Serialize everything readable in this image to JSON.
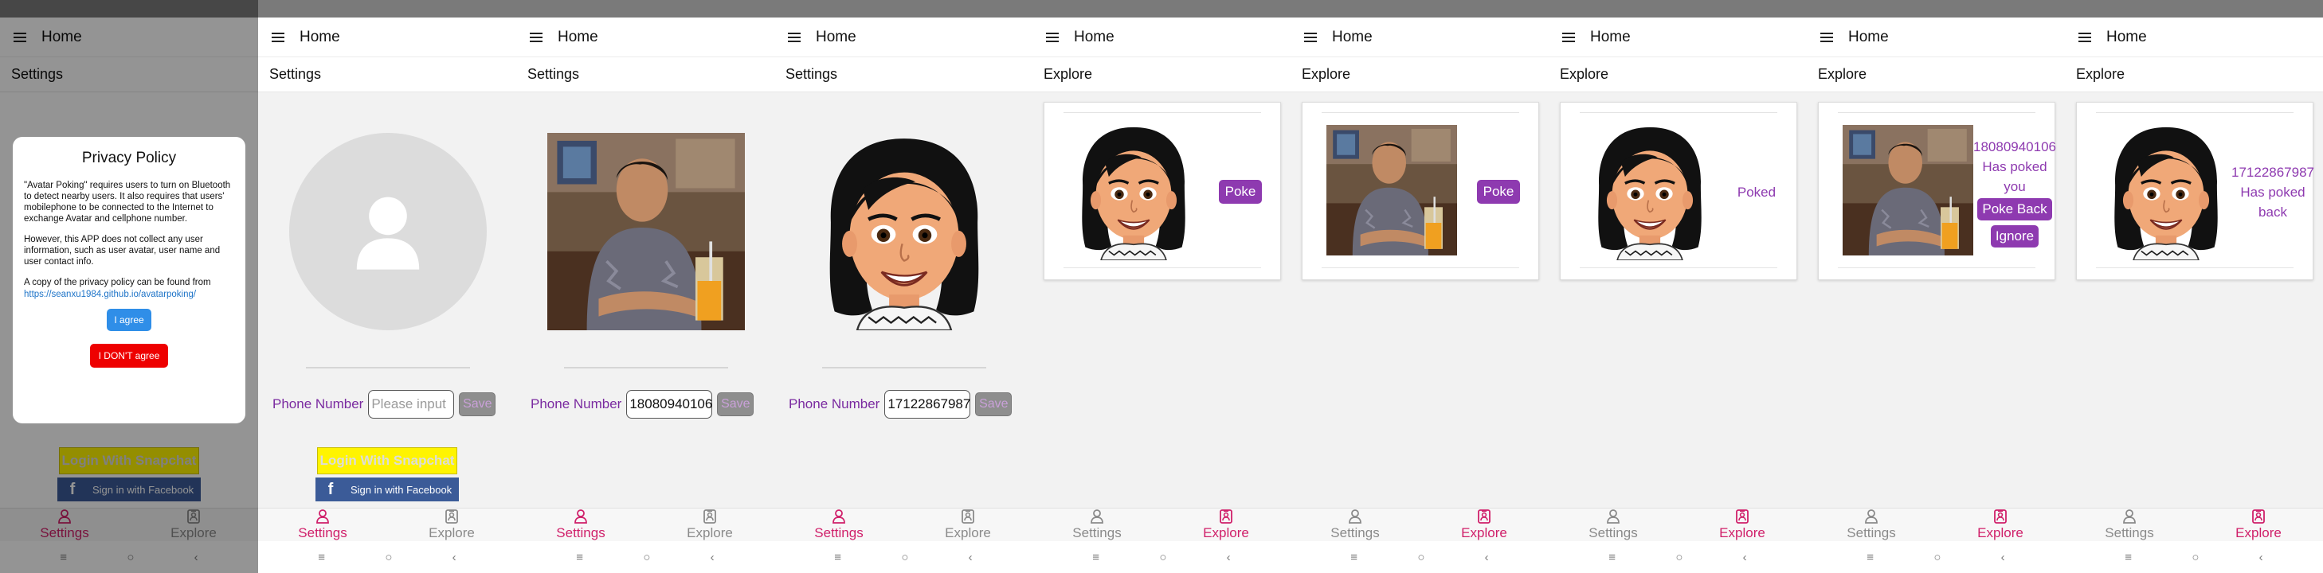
{
  "app": {
    "title": "Home",
    "nav_settings": "Settings",
    "nav_explore": "Explore",
    "sys_recents": "≡",
    "sys_home": "○",
    "sys_back": "‹"
  },
  "colors": {
    "status_bar": "#7a7a7a",
    "accent_purple": "#8e3ab0",
    "nav_active": "#d0206a",
    "snapchat_yellow": "#fff400",
    "facebook_blue": "#3b5b98",
    "agree_blue": "#2f8ee8",
    "disagree_red": "#ee0000"
  },
  "screens": [
    {
      "section": "Settings",
      "privacy": {
        "title": "Privacy Policy",
        "p1": "\"Avatar Poking\" requires users to turn on Bluetooth to detect nearby users. It also requires that users' mobilephone to be connected to the Internet to exchange Avatar and cellphone number.",
        "p2": "However, this APP does not collect any user information, such as user avatar, user name and user contact info.",
        "p3": "A copy of the privacy policy can be found from",
        "link": "https://seanxu1984.github.io/avatarpoking/",
        "agree": "I agree",
        "disagree": "I DON'T agree"
      },
      "snapchat": "Login With Snapchat",
      "facebook": "Sign in with Facebook",
      "active_tab": "settings"
    },
    {
      "section": "Settings",
      "avatar": "placeholder-person-icon",
      "phone_label": "Phone Number",
      "phone_placeholder": "Please input",
      "save": "Save",
      "snapchat": "Login With Snapchat",
      "facebook": "Sign in with Facebook",
      "active_tab": "settings"
    },
    {
      "section": "Settings",
      "avatar": "user-photo",
      "phone_label": "Phone Number",
      "phone_value": "18080940106",
      "save": "Save",
      "active_tab": "settings"
    },
    {
      "section": "Settings",
      "avatar": "cartoon-avatar",
      "phone_label": "Phone Number",
      "phone_value": "17122867987",
      "save": "Save",
      "active_tab": "settings"
    },
    {
      "section": "Explore",
      "avatar": "cartoon-avatar",
      "action": "Poke",
      "active_tab": "explore"
    },
    {
      "section": "Explore",
      "avatar": "user-photo",
      "action": "Poke",
      "active_tab": "explore"
    },
    {
      "section": "Explore",
      "avatar": "cartoon-avatar",
      "status": "Poked",
      "active_tab": "explore"
    },
    {
      "section": "Explore",
      "avatar": "user-photo",
      "number": "18080940106",
      "status": "Has poked you",
      "poke_back": "Poke Back",
      "ignore": "Ignore",
      "active_tab": "explore"
    },
    {
      "section": "Explore",
      "avatar": "cartoon-avatar",
      "number": "17122867987",
      "status": "Has poked back",
      "active_tab": "explore"
    }
  ]
}
